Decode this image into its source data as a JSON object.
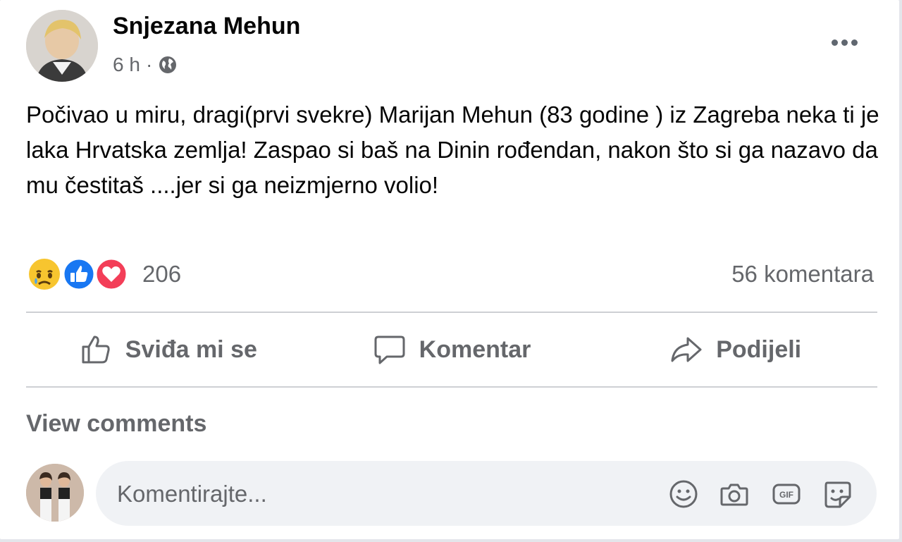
{
  "post": {
    "author": "Snjezana Mehun",
    "time": "6 h",
    "separator": "·",
    "privacy_icon": "globe-icon",
    "text": "Počivao u miru, dragi(prvi svekre) Marijan Mehun (83 godine ) iz Zagreba neka ti je laka Hrvatska zemlja! Zaspao si baš na Dinin rođendan, nakon što si ga nazavo da mu čestitaš ....jer si ga neizmjerno volio!",
    "reactions": {
      "icons": [
        "care-sad-emoji-icon",
        "like-reaction-icon",
        "love-reaction-icon"
      ],
      "count": "206"
    },
    "comments_count": "56 komentara"
  },
  "actions": {
    "like_label": "Sviđa mi se",
    "comment_label": "Komentar",
    "share_label": "Podijeli"
  },
  "view_comments": "View comments",
  "composer": {
    "placeholder": "Komentirajte...",
    "icons": [
      "emoji-icon",
      "camera-icon",
      "gif-icon",
      "sticker-icon"
    ]
  },
  "colors": {
    "secondary_text": "#65676b",
    "like_blue": "#1877f2",
    "love_red": "#f33e58",
    "divider": "#ced0d4",
    "composer_bg": "#f0f2f5"
  }
}
